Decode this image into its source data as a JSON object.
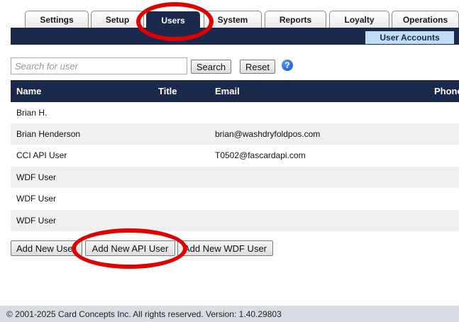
{
  "tabs": [
    {
      "label": "Settings"
    },
    {
      "label": "Setup"
    },
    {
      "label": "Users"
    },
    {
      "label": "System"
    },
    {
      "label": "Reports"
    },
    {
      "label": "Loyalty"
    },
    {
      "label": "Operations"
    }
  ],
  "subnav": {
    "label": "User Accounts"
  },
  "search": {
    "placeholder": "Search for user",
    "value": "",
    "search_label": "Search",
    "reset_label": "Reset",
    "help_glyph": "?"
  },
  "table": {
    "columns": [
      "Name",
      "Title",
      "Email",
      "Phone"
    ],
    "rows": [
      {
        "name": "Brian H.",
        "title": "",
        "email": "",
        "phone": ""
      },
      {
        "name": "Brian Henderson",
        "title": "",
        "email": "brian@washdryfoldpos.com",
        "phone": ""
      },
      {
        "name": "CCI API User",
        "title": "",
        "email": "T0502@fascardapi.com",
        "phone": ""
      },
      {
        "name": "WDF User",
        "title": "",
        "email": "",
        "phone": ""
      },
      {
        "name": "WDF User",
        "title": "",
        "email": "",
        "phone": ""
      },
      {
        "name": "WDF User",
        "title": "",
        "email": "",
        "phone": ""
      }
    ]
  },
  "actions": {
    "add_user": "Add New User",
    "add_api_user": "Add New API User",
    "add_wdf_user": "Add New WDF User"
  },
  "footer": {
    "text": "© 2001-2025 Card Concepts Inc. All rights reserved. Version: 1.40.29803"
  },
  "colors": {
    "navy": "#1b2a4c",
    "subtab": "#c0ddf5",
    "annotation": "#e00000"
  },
  "icons": [
    "help-icon"
  ]
}
